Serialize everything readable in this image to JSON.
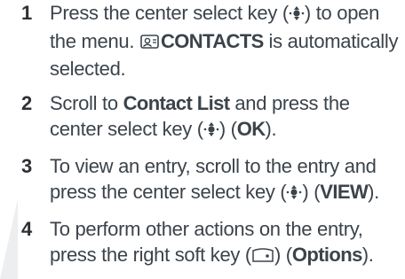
{
  "steps": [
    {
      "number": "1",
      "t1": "Press the center select key (",
      "icon1": "center-select-key-icon",
      "t2": ") to open the menu. ",
      "icon2": "contacts-icon",
      "b1": "CONTACTS",
      "t3": " is automatically selected."
    },
    {
      "number": "2",
      "t1": "Scroll to ",
      "b1": "Contact List",
      "t2": " and press the center select key (",
      "icon1": "center-select-key-icon",
      "t3": ") (",
      "b2": "OK",
      "t4": ")."
    },
    {
      "number": "3",
      "t1": "To view an entry, scroll to the entry and press the center select key (",
      "icon1": "center-select-key-icon",
      "t2": ") (",
      "b1": "VIEW",
      "t3": ")."
    },
    {
      "number": "4",
      "t1": "To perform other actions on the entry, press the right soft key (",
      "icon1": "right-soft-key-icon",
      "t2": ") (",
      "b1": "Options",
      "t3": ")."
    }
  ],
  "colors": {
    "text": "#3b434b",
    "number": "#2e3033",
    "watermark": "#e6e8ea"
  }
}
